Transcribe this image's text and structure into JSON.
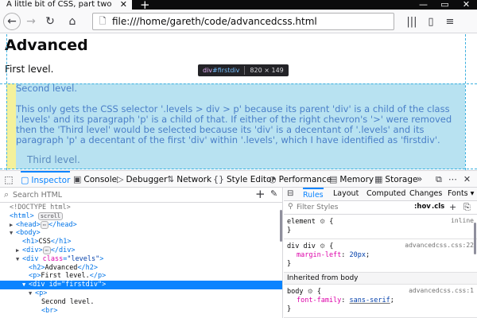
{
  "tab": {
    "title": "A little bit of CSS, part two",
    "close_glyph": "✕",
    "newtab_glyph": "+"
  },
  "window_controls": [
    "—",
    "▭",
    "✕"
  ],
  "nav": {
    "back_glyph": "←",
    "forward_glyph": "→",
    "reload_glyph": "↻",
    "home_glyph": "⌂",
    "url_icon_glyph": "🗋",
    "url": "file:///home/gareth/code/advancedcss.html",
    "library_glyph": "|||",
    "sidebar_glyph": "▯",
    "menu_glyph": "≡"
  },
  "page": {
    "heading": "Advanced",
    "first_level": "First level.",
    "second_level": "Second level.",
    "body_text": "This only gets the CSS selector '.levels > div > p' because its parent 'div' is a child of the class '.levels' and its paragraph 'p' is a child of that. If either of the right chevron's '>' were removed then the 'Third level' would be selected because its 'div' is a decentant of '.levels' and its paragraph 'p' a decentant of the first 'div' within '.levels', which I have identified as 'firstdiv'.",
    "third_level": "Third level.",
    "colors": {
      "highlight_content": "#b8e2f1",
      "highlight_margin": "#f4f19b",
      "highlight_text": "#4a7fc8",
      "guide": "#3cb0df"
    }
  },
  "tooltip": {
    "tag": "div",
    "id": "#firstdiv",
    "dimensions": "820 × 149"
  },
  "devtools": {
    "picker_glyph": "⬚",
    "tabs": [
      {
        "icon": "▢",
        "label": "Inspector"
      },
      {
        "icon": "▣",
        "label": "Console"
      },
      {
        "icon": "▷",
        "label": "Debugger"
      },
      {
        "icon": "⇅",
        "label": "Network"
      },
      {
        "icon": "{}",
        "label": "Style Editor"
      },
      {
        "icon": "◔",
        "label": "Performance"
      },
      {
        "icon": "▤",
        "label": "Memory"
      },
      {
        "icon": "▦",
        "label": "Storage"
      }
    ],
    "more_glyph": "»",
    "right_icons": [
      "⧉",
      "⋯",
      "✕"
    ],
    "selected_color": "#0a84ff"
  },
  "markup": {
    "search_placeholder": "Search HTML",
    "search_glyph": "⌕",
    "add_glyph": "+",
    "pick_glyph": "✎",
    "lines": {
      "doctype": "<!DOCTYPE html>",
      "html_open": "<html>",
      "scroll_badge": "scroll",
      "head_open": "<head>",
      "ellipsis_badge": "⋯",
      "head_close": "</head>",
      "body_open": "<body>",
      "h1_open": "<h1>",
      "h1_text": "CSS",
      "h1_close": "</h1>",
      "div_open": "<div>",
      "div_close": "</div>",
      "levels_tag": "<div",
      "levels_attr": " class",
      "levels_eq": "=",
      "levels_val": "\"levels\"",
      "levels_end": ">",
      "h2_open": "<h2>",
      "h2_text": "Advanced",
      "h2_close": "</h2>",
      "p_open": "<p>",
      "p_text": "First level.",
      "p_close": "</p>",
      "firstdiv_tag": "<div",
      "firstdiv_attr": " id",
      "firstdiv_eq": "=",
      "firstdiv_val": "\"firstdiv\"",
      "firstdiv_end": ">",
      "p2_open": "<p>",
      "second_text": "Second level.",
      "br": "<br>"
    }
  },
  "sidebar": {
    "panel_glyph": "⊟",
    "tabs": [
      "Rules",
      "Layout",
      "Computed",
      "Changes",
      "Fonts"
    ],
    "fonts_arrow": "▾",
    "filter_placeholder": "Filter Styles",
    "filter_glyph": "⚲",
    "hov": ":hov",
    "cls": ".cls",
    "add_glyph": "+",
    "copy_glyph": "⎘",
    "rules": [
      {
        "selector": "element",
        "gear": "⚙",
        "open": "{",
        "close": "}",
        "source": "inline",
        "declarations": []
      },
      {
        "selector": "div div",
        "gear": "⚙",
        "open": "{",
        "close": "}",
        "source": "advancedcss.css:22",
        "declarations": [
          {
            "prop": "margin-left",
            "value": "20px"
          }
        ]
      }
    ],
    "inherited_label": "Inherited from body",
    "inherited_rule": {
      "selector": "body",
      "gear": "⚙",
      "open": "{",
      "close": "}",
      "source": "advancedcss.css:1",
      "declarations": [
        {
          "prop": "font-family",
          "value": "sans-serif"
        }
      ]
    }
  }
}
